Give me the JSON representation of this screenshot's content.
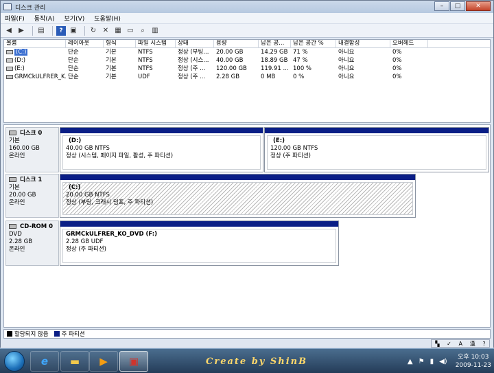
{
  "window": {
    "title": "디스크 관리",
    "controls": {
      "minimize": "–",
      "maximize": "□",
      "close": "✕"
    }
  },
  "menu": [
    "파일(F)",
    "동작(A)",
    "보기(V)",
    "도움말(H)"
  ],
  "toolbar": {
    "icons": [
      "back-arrow-icon",
      "forward-arrow-icon",
      "console-tree-icon",
      "help-icon",
      "show-hide-icon",
      "refresh-icon",
      "delete-icon",
      "properties-icon",
      "open-icon",
      "search-icon",
      "disk-view-icon"
    ],
    "help_glyph": "?"
  },
  "volume_list": {
    "columns": [
      "볼륨",
      "레이아웃",
      "형식",
      "파일 시스템",
      "상태",
      "용량",
      "남은 공...",
      "남은 공간 %",
      "내결함성",
      "오버헤드"
    ],
    "rows": [
      [
        "(C:)",
        "단순",
        "기본",
        "NTFS",
        "정상 (부팅...",
        "20.00 GB",
        "14.29 GB",
        "71 %",
        "아니요",
        "0%"
      ],
      [
        "(D:)",
        "단순",
        "기본",
        "NTFS",
        "정상 (시스...",
        "40.00 GB",
        "18.89 GB",
        "47 %",
        "아니요",
        "0%"
      ],
      [
        "(E:)",
        "단순",
        "기본",
        "NTFS",
        "정상 (주 ...",
        "120.00 GB",
        "119.91 ...",
        "100 %",
        "아니요",
        "0%"
      ],
      [
        "GRMCkULFRER_K...",
        "단순",
        "기본",
        "UDF",
        "정상 (주 ...",
        "2.28 GB",
        "0 MB",
        "0 %",
        "아니요",
        "0%"
      ]
    ]
  },
  "disks": [
    {
      "name": "디스크 0",
      "type": "기본",
      "size": "160.00 GB",
      "state": "온라인",
      "partitions": [
        {
          "name": "(D:)",
          "size": "40.00 GB NTFS",
          "status": "정상 (시스템, 페이지 파일, 활성, 주 파티션)"
        },
        {
          "name": "(E:)",
          "size": "120.00 GB NTFS",
          "status": "정상 (주 파티션)"
        }
      ]
    },
    {
      "name": "디스크 1",
      "type": "기본",
      "size": "20.00 GB",
      "state": "온라인",
      "partitions": [
        {
          "name": "(C:)",
          "size": "20.00 GB NTFS",
          "status": "정상 (부팅, 크래시 덤프, 주 파티션)"
        }
      ]
    },
    {
      "name": "CD-ROM 0",
      "type": "DVD",
      "size": "2.28 GB",
      "state": "온라인",
      "partitions": [
        {
          "name": "GRMCkULFRER_KO_DVD  (F:)",
          "size": "2.28 GB UDF",
          "status": "정상 (주 파티션)"
        }
      ]
    }
  ],
  "legend": [
    {
      "label": "할당되지 않음",
      "color": "#000000"
    },
    {
      "label": "주 파티션",
      "color": "#0a1e86"
    }
  ],
  "langbar": {
    "ime": "A",
    "hanja": "漢"
  },
  "taskbar": {
    "brand": "Create by ShinB",
    "clock": {
      "time": "오후 10:03",
      "date": "2009-11-23"
    }
  },
  "colors": {
    "primary_partition": "#0a1e86",
    "selection": "#3a6ed0"
  }
}
